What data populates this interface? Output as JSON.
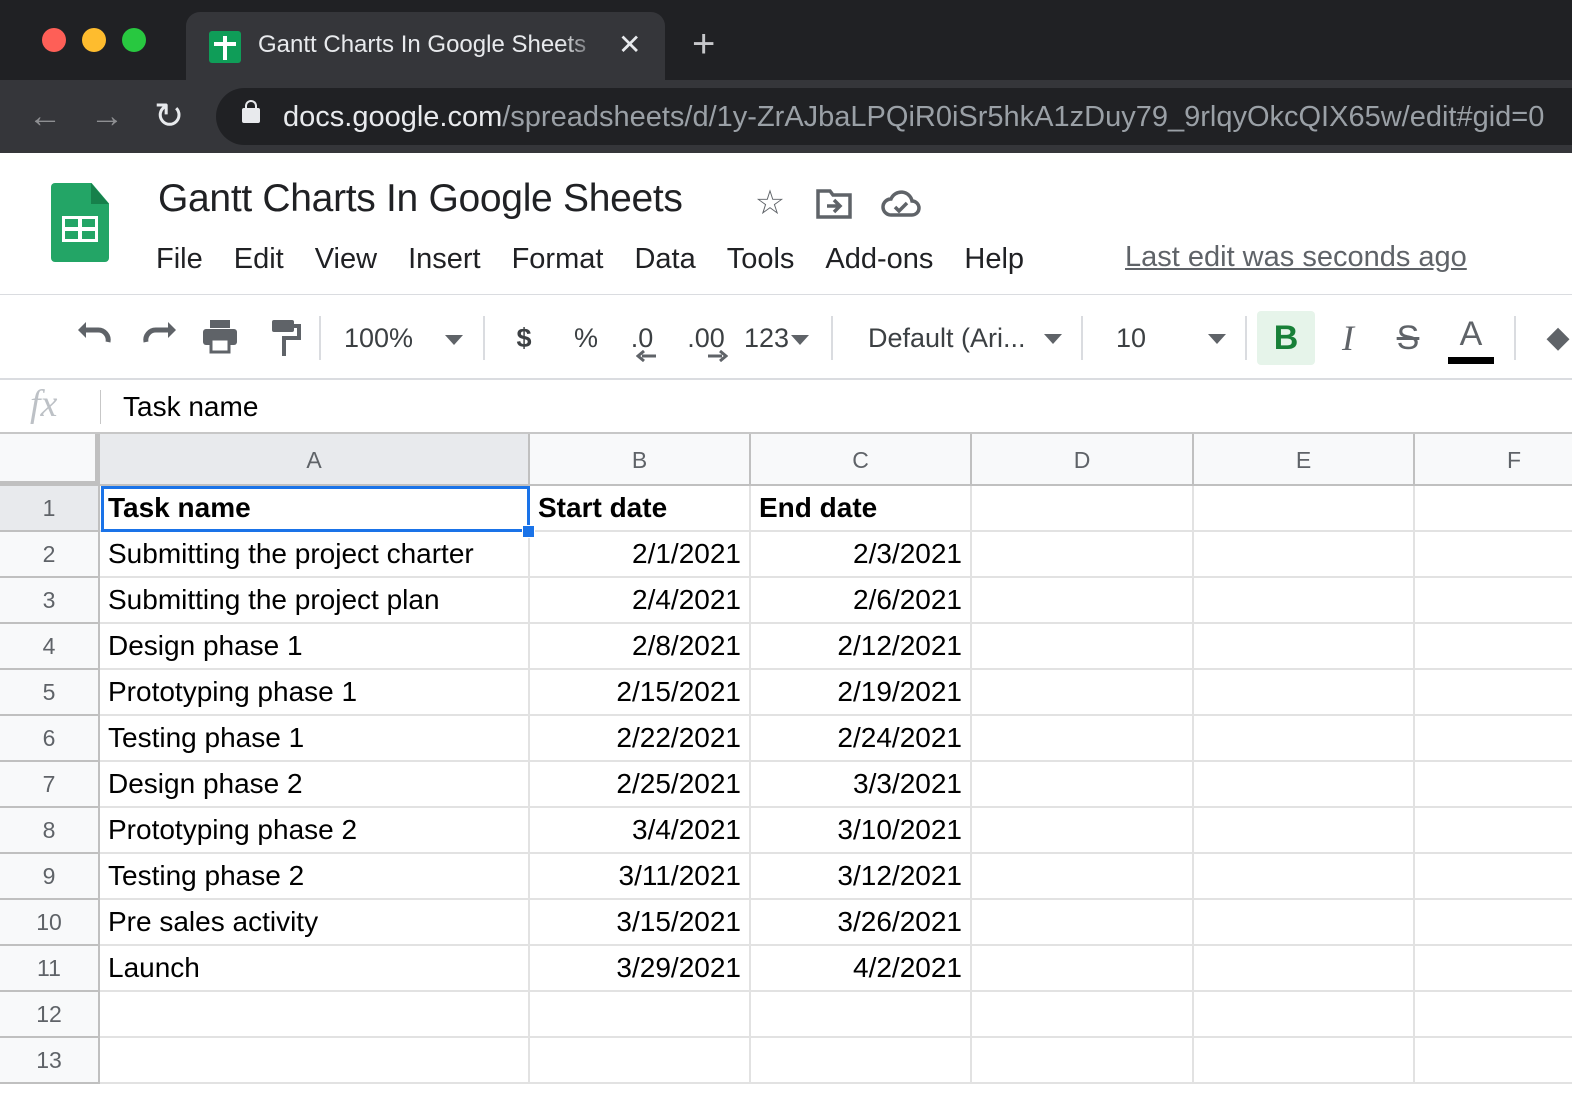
{
  "browser": {
    "tab_title": "Gantt Charts In Google Sheets",
    "tab_close_glyph": "✕",
    "new_tab_glyph": "+",
    "back_glyph": "←",
    "forward_glyph": "→",
    "reload_glyph": "↻",
    "url_host": "docs.google.com",
    "url_path": "/spreadsheets/d/1y-ZrAJbaLPQiR0iSr5hkA1zDuy79_9rlqyOkcQIX65w/edit#gid=0"
  },
  "app": {
    "doc_title": "Gantt Charts In Google Sheets",
    "icons": {
      "star": "☆",
      "move": "⇥",
      "cloud": "☁"
    },
    "menu": [
      "File",
      "Edit",
      "View",
      "Insert",
      "Format",
      "Data",
      "Tools",
      "Add-ons",
      "Help"
    ],
    "last_edit": "Last edit was seconds ago"
  },
  "toolbar": {
    "undo": "↶",
    "redo": "↷",
    "print": "⎙",
    "paint_format": "🖌",
    "zoom": "100%",
    "currency": "$",
    "percent": "%",
    "decrease_decimal": ".0",
    "increase_decimal": ".00",
    "more_formats": "123",
    "font": "Default (Ari...",
    "font_size": "10",
    "bold": "B",
    "italic": "I",
    "strikethrough": "S",
    "text_color": "A",
    "text_color_value": "#000000",
    "fill": "◆"
  },
  "formula_bar": {
    "fx_label": "fx",
    "content": "Task name"
  },
  "sheet": {
    "columns": [
      "A",
      "B",
      "C",
      "D",
      "E",
      "F"
    ],
    "selected_cell": "A1",
    "row_numbers": [
      "1",
      "2",
      "3",
      "4",
      "5",
      "6",
      "7",
      "8",
      "9",
      "10",
      "11",
      "12",
      "13"
    ],
    "header_row": [
      "Task name",
      "Start date",
      "End date"
    ],
    "rows": [
      [
        "Submitting the project charter",
        "2/1/2021",
        "2/3/2021"
      ],
      [
        "Submitting the project plan",
        "2/4/2021",
        "2/6/2021"
      ],
      [
        "Design phase 1",
        "2/8/2021",
        "2/12/2021"
      ],
      [
        "Prototyping phase 1",
        "2/15/2021",
        "2/19/2021"
      ],
      [
        "Testing phase 1",
        "2/22/2021",
        "2/24/2021"
      ],
      [
        "Design phase 2",
        "2/25/2021",
        "3/3/2021"
      ],
      [
        "Prototyping phase 2",
        "3/4/2021",
        "3/10/2021"
      ],
      [
        "Testing phase 2",
        "3/11/2021",
        "3/12/2021"
      ],
      [
        "Pre sales activity",
        "3/15/2021",
        "3/26/2021"
      ],
      [
        "Launch",
        "3/29/2021",
        "4/2/2021"
      ]
    ]
  }
}
